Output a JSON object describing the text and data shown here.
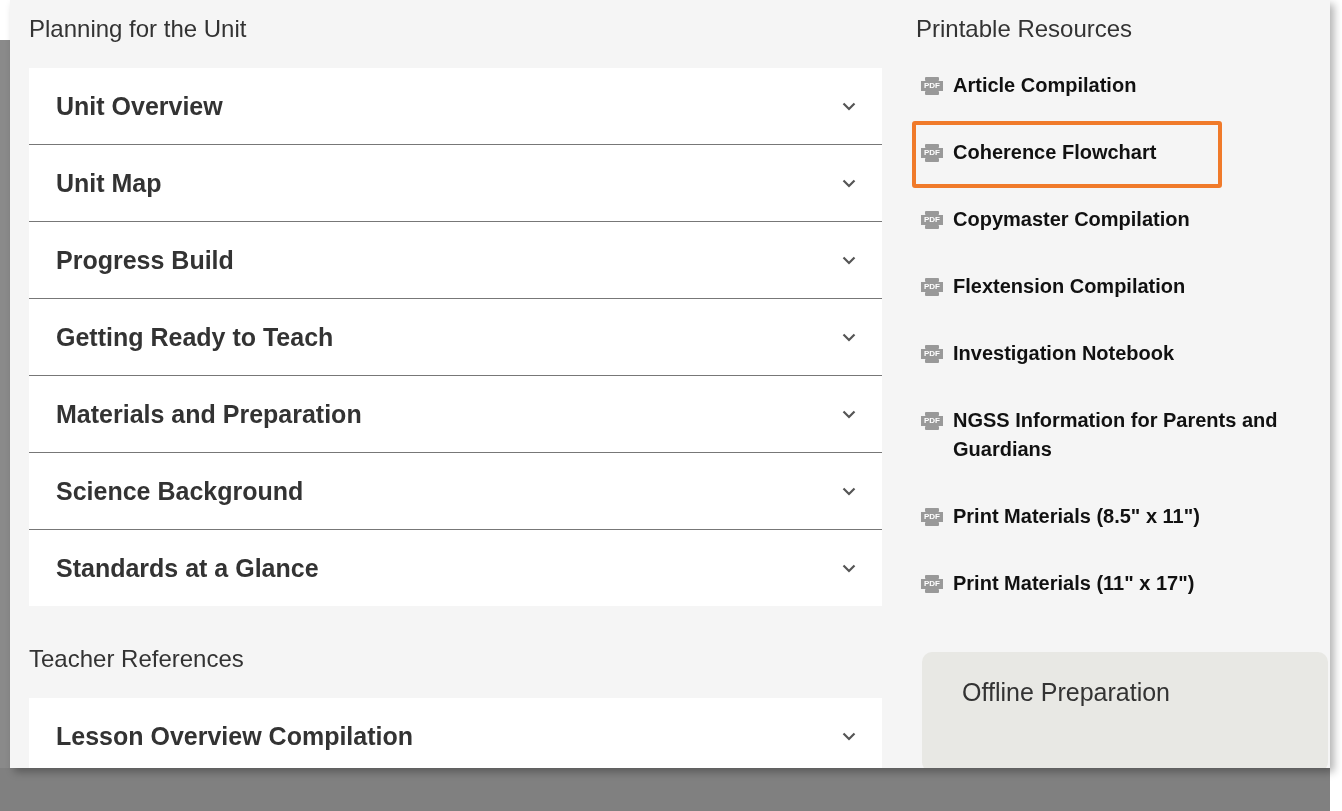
{
  "sections": [
    {
      "heading": "Planning for the Unit",
      "items": [
        {
          "label": "Unit Overview",
          "expanded": false
        },
        {
          "label": "Unit Map",
          "expanded": false
        },
        {
          "label": "Progress Build",
          "expanded": false
        },
        {
          "label": "Getting Ready to Teach",
          "expanded": false
        },
        {
          "label": "Materials and Preparation",
          "expanded": false
        },
        {
          "label": "Science Background",
          "expanded": false
        },
        {
          "label": "Standards at a Glance",
          "expanded": false
        }
      ]
    },
    {
      "heading": "Teacher References",
      "items": [
        {
          "label": "Lesson Overview Compilation",
          "expanded": false
        }
      ]
    }
  ],
  "printable_resources": {
    "heading": "Printable Resources",
    "items": [
      {
        "icon_text": "PDF",
        "label": "Article Compilation",
        "highlighted": false
      },
      {
        "icon_text": "PDF",
        "label": "Coherence Flowchart",
        "highlighted": true
      },
      {
        "icon_text": "PDF",
        "label": "Copymaster Compilation",
        "highlighted": false
      },
      {
        "icon_text": "PDF",
        "label": "Flextension Compilation",
        "highlighted": false
      },
      {
        "icon_text": "PDF",
        "label": "Investigation Notebook",
        "highlighted": false
      },
      {
        "icon_text": "PDF",
        "label": "NGSS Information for Parents and Guardians",
        "highlighted": false
      },
      {
        "icon_text": "PDF",
        "label": "Print Materials (8.5\" x 11\")",
        "highlighted": false
      },
      {
        "icon_text": "PDF",
        "label": "Print Materials (11\" x 17\")",
        "highlighted": false
      }
    ]
  },
  "offline_card": {
    "title": "Offline Preparation"
  }
}
